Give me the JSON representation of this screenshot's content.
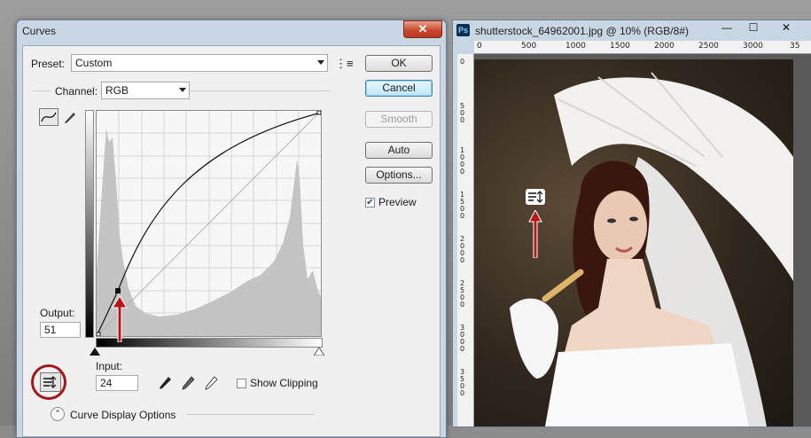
{
  "curves_dialog": {
    "title": "Curves",
    "close_glyph": "✕",
    "preset_label": "Preset:",
    "preset_value": "Custom",
    "channel_label": "Channel:",
    "channel_value": "RGB",
    "output_label": "Output:",
    "output_value": "51",
    "input_label": "Input:",
    "input_value": "24",
    "show_clipping_label": "Show Clipping",
    "curve_display_options_label": "Curve Display Options",
    "buttons": {
      "ok": "OK",
      "cancel": "Cancel",
      "smooth": "Smooth",
      "auto": "Auto",
      "options": "Options...",
      "preview": "Preview"
    },
    "preview_checked": true,
    "show_clipping_checked": false,
    "tools": [
      "curve-point-icon",
      "pencil-icon",
      "on-image-adjust-icon"
    ],
    "eyedroppers": [
      "black-eyedropper-icon",
      "gray-eyedropper-icon",
      "white-eyedropper-icon"
    ]
  },
  "document_window": {
    "app_icon": "Ps",
    "title": "shutterstock_64962001.jpg @ 10% (RGB/8#)",
    "controls": {
      "minimize": "—",
      "maximize": "☐",
      "close": "✕"
    },
    "ruler_h_labels": [
      "0",
      "500",
      "1000",
      "1500",
      "2000",
      "2500",
      "3000",
      "35"
    ],
    "ruler_v_labels": [
      "0",
      "5\n0\n0",
      "1\n0\n0\n0",
      "1\n5\n0\n0",
      "2\n0\n0\n0",
      "2\n5\n0\n0",
      "3\n0\n0\n0",
      "3\n5\n0\n0"
    ]
  },
  "colors": {
    "annotation_red": "#b8151d",
    "dialog_frame": "#c9d6e3",
    "default_button": "#bee6fd"
  }
}
